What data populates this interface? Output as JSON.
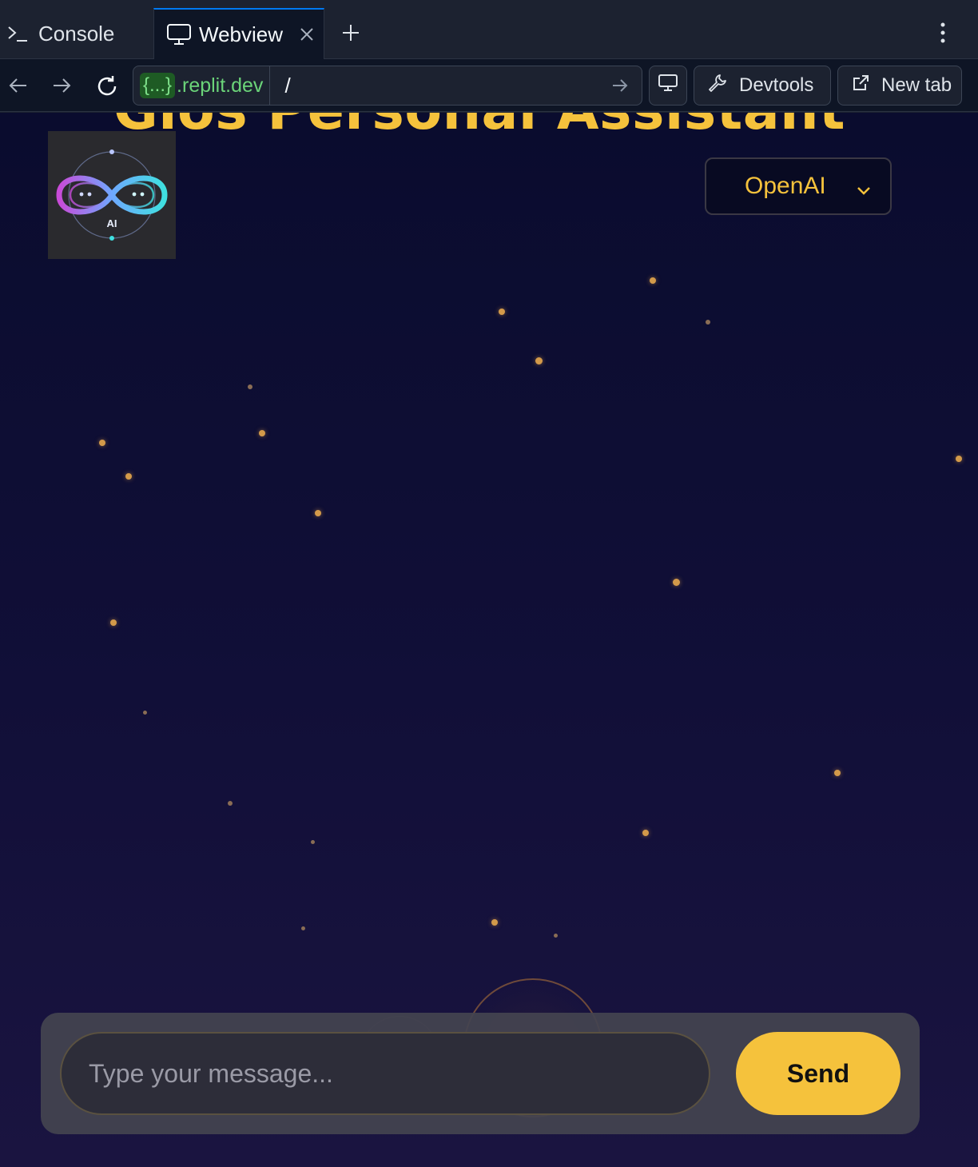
{
  "tabs": {
    "console_label": "Console",
    "webview_label": "Webview"
  },
  "urlbar": {
    "host_badge": "{...}",
    "host_domain": ".replit.dev",
    "path": "/",
    "devtools_label": "Devtools",
    "newtab_label": "New tab"
  },
  "app": {
    "title": "Gios Personal Assistant",
    "logo_text": "AI",
    "model_selected": "OpenAI",
    "input_placeholder": "Type your message...",
    "send_label": "Send"
  },
  "colors": {
    "accent": "#f5c23c",
    "tab_active": "#0079f2",
    "host_green": "#6bd479"
  },
  "icons": [
    "terminal-icon",
    "monitor-icon",
    "close-icon",
    "plus-icon",
    "kebab-icon",
    "arrow-left-icon",
    "arrow-right-icon",
    "reload-icon",
    "go-arrow-icon",
    "screen-icon",
    "wrench-icon",
    "external-link-icon",
    "chevron-down-icon",
    "infinity-logo-icon"
  ]
}
